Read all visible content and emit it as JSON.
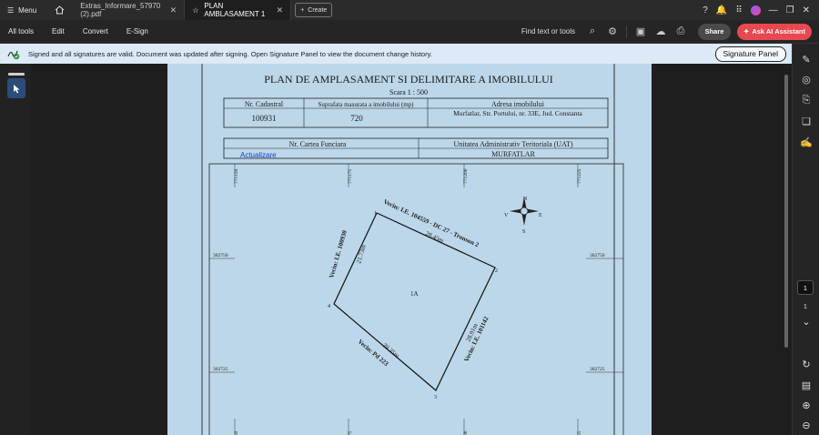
{
  "titlebar": {
    "menu_label": "Menu",
    "tabs": [
      {
        "label": "Extras_Informare_57970 (2).pdf",
        "active": false
      },
      {
        "label": "PLAN AMBLASAMENT 1",
        "active": true
      }
    ],
    "create_label": "Create"
  },
  "toolbar": {
    "items": [
      "All tools",
      "Edit",
      "Convert",
      "E-Sign"
    ],
    "find_label": "Find text or tools",
    "share_label": "Share",
    "ask_ai_label": "Ask AI Assistant"
  },
  "signature_bar": {
    "message": "Signed and all signatures are valid. Document was updated after signing. Open Signature Panel to view the document change history.",
    "button_label": "Signature Panel"
  },
  "page_nav": {
    "current": "1",
    "total": "1"
  },
  "document": {
    "title": "PLAN DE AMPLASAMENT SI DELIMITARE A IMOBILULUI",
    "scale": "Scara 1 : 500",
    "table1_headers": [
      "Nr. Cadastral",
      "Suprafata masurata a imobilului (mp)",
      "Adresa imobilului"
    ],
    "table1_values": [
      "100931",
      "720",
      "Murfatlar, Str. Portului, nr. 33E, Jud. Constanta"
    ],
    "table2_headers": [
      "Nr. Cartea Funciara",
      "Unitatea Administrativ Teritoriala (UAT)"
    ],
    "table2_values": [
      "Actualizare",
      "MURFATLAR"
    ],
    "grid_top": [
      "771150",
      "771175",
      "771200",
      "771225"
    ],
    "grid_bottom": [
      "771150",
      "771175",
      "771200",
      "771225"
    ],
    "grid_left": [
      "302750",
      "302725"
    ],
    "grid_right": [
      "302750",
      "302725"
    ],
    "parcel_label": "1A",
    "vertices": [
      "1",
      "2",
      "3",
      "4"
    ],
    "edge_lengths": [
      "28.45m",
      "28.91m",
      "29.35m",
      "21.73m"
    ],
    "neighbors": [
      "Vecin: I.E. 104559 - DC 27 - Tronson 2",
      "Vecin: I.E. 101142",
      "Vecin: Pd 223",
      "Vecin: I.E. 100930"
    ],
    "compass": {
      "n": "N",
      "s": "S",
      "e": "E",
      "w": "V"
    }
  }
}
